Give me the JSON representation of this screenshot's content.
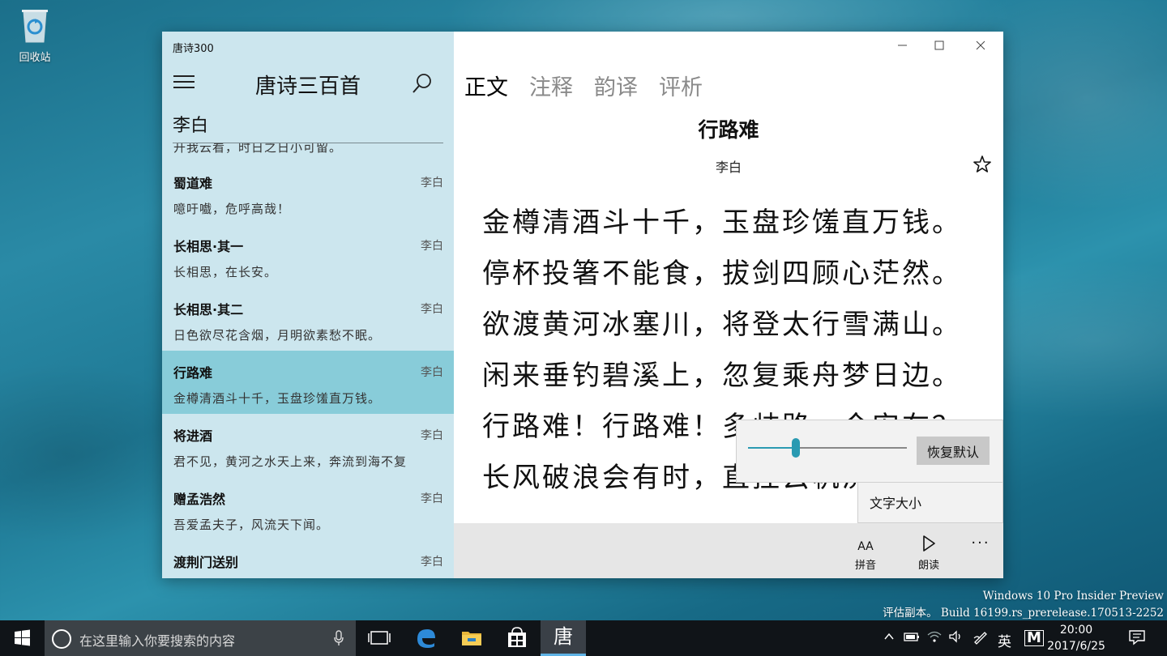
{
  "desktop": {
    "recycle_bin_label": "回收站"
  },
  "window": {
    "app_title": "唐诗300",
    "sidebar_heading": "唐诗三百首",
    "poet_filter": "李白",
    "list_peek_text": "开我云看，时日之日小可留。",
    "poems": [
      {
        "title": "蜀道难",
        "author": "李白",
        "first_line": "噫吁嚱，危呼高哉！",
        "selected": false
      },
      {
        "title": "长相思·其一",
        "author": "李白",
        "first_line": "长相思，在长安。",
        "selected": false
      },
      {
        "title": "长相思·其二",
        "author": "李白",
        "first_line": "日色欲尽花含烟，月明欲素愁不眠。",
        "selected": false
      },
      {
        "title": "行路难",
        "author": "李白",
        "first_line": "金樽清酒斗十千，玉盘珍馐直万钱。",
        "selected": true
      },
      {
        "title": "将进酒",
        "author": "李白",
        "first_line": "君不见，黄河之水天上来，奔流到海不复",
        "selected": false
      },
      {
        "title": "赠孟浩然",
        "author": "李白",
        "first_line": "吾爱孟夫子，风流天下闻。",
        "selected": false
      },
      {
        "title": "渡荆门送别",
        "author": "李白",
        "first_line": "",
        "selected": false
      }
    ],
    "tabs": [
      {
        "label": "正文",
        "active": true
      },
      {
        "label": "注释",
        "active": false
      },
      {
        "label": "韵译",
        "active": false
      },
      {
        "label": "评析",
        "active": false
      }
    ],
    "poem": {
      "title": "行路难",
      "author": "李白",
      "lines": [
        "金樽清酒斗十千，玉盘珍馐直万钱。",
        "停杯投箸不能食，拔剑四顾心茫然。",
        "欲渡黄河冰塞川，将登太行雪满山。",
        "闲来垂钓碧溪上，忽复乘舟梦日边。",
        "行路难！行路难！多歧路，今安在？",
        "长风破浪会有时，直挂云帆济沧海。"
      ]
    },
    "font_size_flyout": {
      "slider_value": 0.3,
      "reset_label": "恢复默认"
    },
    "menu_item_label": "文字大小",
    "command_bar": {
      "pinyin_label": "拼音",
      "pinyin_icon_text": "AA",
      "read_label": "朗读",
      "more_label": "···"
    },
    "accent_color": "#88ccd9",
    "sidebar_color": "#cce6ee"
  },
  "watermark": {
    "line1": "Windows 10 Pro Insider Preview",
    "line2": "评估副本。 Build 16199.rs_prerelease.170513-2252"
  },
  "taskbar": {
    "search_placeholder": "在这里输入你要搜索的内容",
    "active_app_glyph": "唐",
    "ime_mode": "英",
    "ime_extra": "M",
    "time": "20:00",
    "date": "2017/6/25"
  }
}
